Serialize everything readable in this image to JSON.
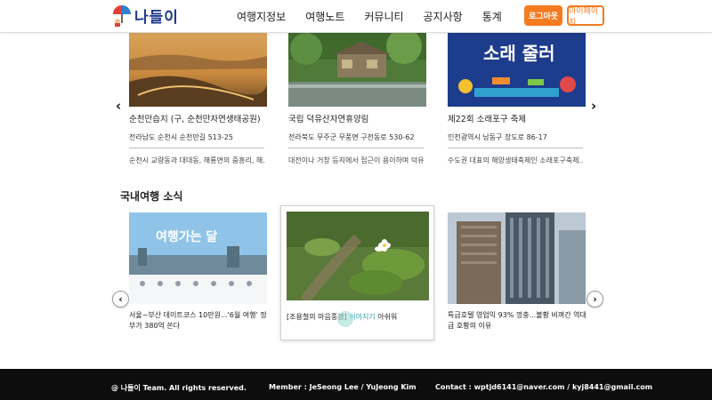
{
  "header": {
    "logo_text": "나들이",
    "nav": [
      "여행지정보",
      "여행노트",
      "커뮤니티",
      "공지사항",
      "통계"
    ],
    "logout_label": "로그아웃",
    "mypage_label": "마이페이지"
  },
  "places": [
    {
      "title": "순천만습지 (구, 순천만자연생태공원)",
      "address": "전라남도 순천시 순천만길 513-25",
      "desc": "순천시 교량동과 대대동, 해룡면의 중흥리, 해..."
    },
    {
      "title": "국립 덕유산자연휴양림",
      "address": "전라북도 무주군 무풍면 구천동로 530-62",
      "desc": "대전이나 거창 등지에서 접근이 용이하며 덕유..."
    },
    {
      "title": "제22회 소래포구 축제",
      "address": "인천광역시 남동구 장도로 86-17",
      "desc": "수도권 대표의 해양생태축제인 소래포구축제..."
    }
  ],
  "news_section_title": "국내여행 소식",
  "news": [
    {
      "caption": "서울~부산 데이트코스 10만원...'6월 여행' 정부가 380억 쏜다",
      "thumb_text": "여행가는 달"
    },
    {
      "caption_pre": "[조용철의 마음풍경] ",
      "caption_link": "쉬어지기",
      "caption_post": " 아쉬워"
    },
    {
      "caption": "특급호텔 영업익 93% 껑충...불황 비껴간 역대급 호황의 이유"
    }
  ],
  "footer": {
    "copyright": "@ 나들이 Team. All rights reserved.",
    "members": "Member : JeSeong Lee / YuJeong Kim",
    "contact": "Contact : wptjd6141@naver.com / kyj8441@gmail.com"
  },
  "festival_poster_text": "소래 줄러"
}
